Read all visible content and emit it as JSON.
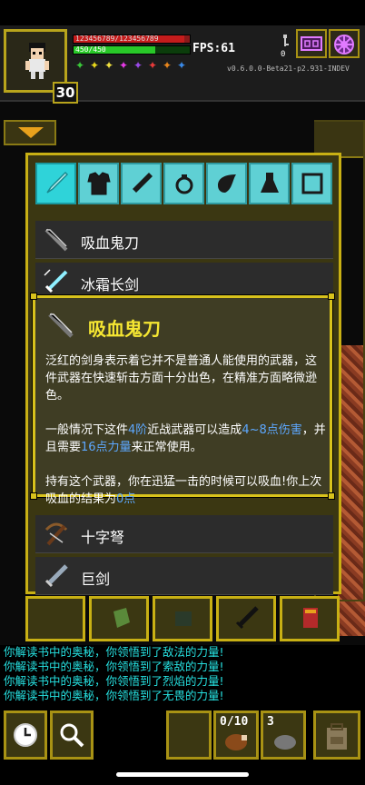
{
  "status": {
    "hp_text": "123456789/123456789",
    "mp_text": "450/450",
    "hp_fraction": 0.95,
    "mp_fraction": 0.7,
    "fps_label": "FPS:61",
    "level": "30",
    "version": "v0.6.0.0-Beta21-p2.931-INDEV",
    "key_count": "0",
    "buff_icons": [
      "green-star-icon",
      "yellow-star-icon",
      "yellow-burst-icon",
      "magenta-star-icon",
      "purple-star-icon",
      "red-star-icon",
      "orange-star-icon",
      "blue-star-icon"
    ],
    "buff_colors": [
      "#3ac83a",
      "#e8d81c",
      "#f0e040",
      "#e83ae8",
      "#9a4ae8",
      "#e83a3a",
      "#e8861c",
      "#3a8ae8"
    ]
  },
  "inventory": {
    "tabs": [
      "all-items-tab",
      "armor-tab",
      "wand-tab",
      "ring-tab",
      "artifact-tab",
      "potion-tab",
      "scroll-tab"
    ],
    "items": [
      {
        "label": "吸血鬼刀",
        "icon": "vampire-knife-icon"
      },
      {
        "label": "冰霜长剑",
        "icon": "frost-sword-icon"
      },
      {
        "label": "十字弩",
        "icon": "crossbow-icon"
      },
      {
        "label": "巨剑",
        "icon": "greatsword-icon"
      }
    ]
  },
  "detail": {
    "title": "吸血鬼刀",
    "desc1": "泛红的剑身表示着它并不是普通人能使用的武器，这件武器在快速斩击方面十分出色，在精准方面略微逊色。",
    "desc2_a": "一般情况下这件",
    "desc2_tier": "4阶",
    "desc2_b": "近战武器可以造成",
    "desc2_dmg": "4~8点伤害",
    "desc2_c": "，并且需要",
    "desc2_str": "16点力量",
    "desc2_d": "来正常使用。",
    "desc3_a": "持有这个武器，你在迅猛一击的时候可以吸血!你上次吸血的结果为",
    "desc3_val": "0点"
  },
  "log": [
    "你解读书中的奥秘，你领悟到了敌法的力量!",
    "你解读书中的奥秘，你领悟到了索敌的力量!",
    "你解读书中的奥秘，你领悟到了烈焰的力量!",
    "你解读书中的奥秘，你领悟到了无畏的力量!"
  ],
  "toolbar": {
    "quickslot1_count": "0/10",
    "quickslot2_count": "3"
  }
}
